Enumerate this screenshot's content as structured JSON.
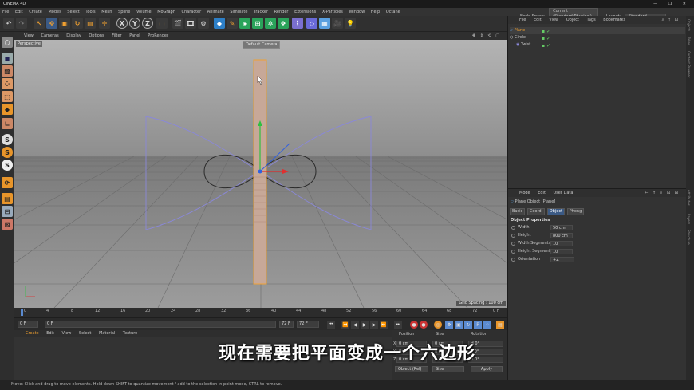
{
  "app": {
    "title": "CINEMA 4D",
    "window_controls": "— ❐ ✕"
  },
  "menu": [
    "File",
    "Edit",
    "Create",
    "Modes",
    "Select",
    "Tools",
    "Mesh",
    "Spline",
    "Volume",
    "MoGraph",
    "Character",
    "Animate",
    "Simulate",
    "Tracker",
    "Render",
    "Extensions",
    "X-Particles",
    "Window",
    "Help",
    "Octane"
  ],
  "node_space": {
    "label": "Node Space:",
    "value": "Current (Standard/Physical)"
  },
  "layout": {
    "label": "Layout:",
    "value": "Standard"
  },
  "toolbar": {
    "axis_x": "X",
    "axis_y": "Y",
    "axis_z": "Z"
  },
  "viewport": {
    "menu": [
      "View",
      "Cameras",
      "Display",
      "Options",
      "Filter",
      "Panel",
      "ProRender"
    ],
    "view_name": "Perspective",
    "camera": "Default Camera",
    "grid_spacing": "Grid Spacing : 100 cm"
  },
  "timeline": {
    "ticks": [
      "0",
      "4",
      "8",
      "12",
      "16",
      "20",
      "24",
      "28",
      "32",
      "36",
      "40",
      "44",
      "48",
      "52",
      "56",
      "60",
      "64",
      "68",
      "72"
    ],
    "end_frame_label": "0 F"
  },
  "playback": {
    "current": "0 F",
    "start": "0 F",
    "end": "72 F",
    "end2": "72 F"
  },
  "material_menu": [
    "Create",
    "Edit",
    "View",
    "Select",
    "Material",
    "Texture"
  ],
  "coords": {
    "headers": [
      "Position",
      "Size",
      "Rotation"
    ],
    "rows": [
      {
        "axis": "X",
        "pos": "0 cm",
        "size": "0 cm",
        "rot": "H 0°"
      },
      {
        "axis": "Y",
        "pos": "0 cm",
        "size": "0 cm",
        "rot": "P 0°"
      },
      {
        "axis": "Z",
        "pos": "0 cm",
        "size": "0 cm",
        "rot": "B 0°"
      }
    ],
    "mode1": "Object (Rel)",
    "mode2": "Size",
    "apply": "Apply"
  },
  "objects": {
    "menu": [
      "File",
      "Edit",
      "View",
      "Object",
      "Tags",
      "Bookmarks"
    ],
    "items": [
      {
        "name": "Plane",
        "selected": true
      },
      {
        "name": "Circle",
        "selected": false
      },
      {
        "name": "Twist",
        "selected": false
      }
    ]
  },
  "attributes": {
    "menu": [
      "Mode",
      "Edit",
      "User Data"
    ],
    "header": "Plane Object [Plane]",
    "tabs": [
      "Basic",
      "Coord.",
      "Object",
      "Phong"
    ],
    "active_tab": "Object",
    "section": "Object Properties",
    "props": [
      {
        "label": "Width",
        "value": "50 cm"
      },
      {
        "label": "Height",
        "value": "800 cm"
      },
      {
        "label": "Width Segments",
        "value": "10"
      },
      {
        "label": "Height Segments",
        "value": "10"
      },
      {
        "label": "Orientation",
        "value": "+Z"
      }
    ]
  },
  "side_tabs": [
    "Objects",
    "Takes",
    "Content Browser",
    "Attributes",
    "Layers",
    "Structure"
  ],
  "subtitle": "现在需要把平面变成一个六边形",
  "status": "Move: Click and drag to move elements. Hold down SHIFT to quantize movement / add to the selection in point mode, CTRL to remove.",
  "colors": {
    "accent": "#3b5a85",
    "selection": "#f0a030",
    "deformer": "#8a88d8"
  }
}
